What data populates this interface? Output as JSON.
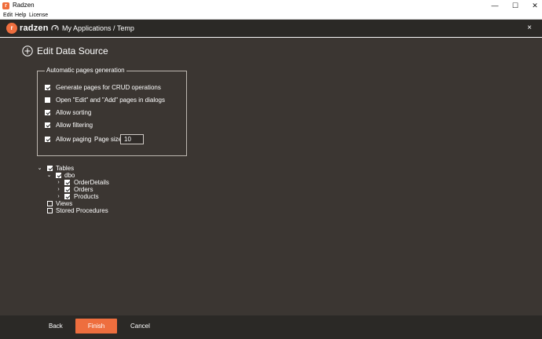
{
  "window": {
    "title": "Radzen",
    "logo_letter": "r",
    "minimize_glyph": "—",
    "maximize_glyph": "☐",
    "close_glyph": "✕"
  },
  "menu": {
    "items": [
      "Edit",
      "Help",
      "License"
    ]
  },
  "header": {
    "brand": "radzen",
    "brand_icon_letter": "r",
    "breadcrumb": "My Applications / Temp",
    "breadcrumb_icon": "gauge-icon",
    "close_glyph": "×"
  },
  "page": {
    "title": "Edit Data Source",
    "title_icon": "add-circle-icon"
  },
  "generation": {
    "legend": "Automatic pages generation",
    "options": [
      {
        "label": "Generate pages for CRUD operations",
        "checked": true
      },
      {
        "label": "Open \"Edit\" and \"Add\" pages in dialogs",
        "checked": false
      },
      {
        "label": "Allow sorting",
        "checked": true
      },
      {
        "label": "Allow filtering",
        "checked": true
      },
      {
        "label": "Allow paging",
        "checked": true
      }
    ],
    "page_size_label": "Page size",
    "page_size_value": "10"
  },
  "tree": {
    "tables": {
      "label": "Tables",
      "checked": true,
      "expanded": true
    },
    "dbo": {
      "label": "dbo",
      "checked": true,
      "expanded": true
    },
    "items": [
      {
        "label": "OrderDetails",
        "checked": true
      },
      {
        "label": "Orders",
        "checked": true
      },
      {
        "label": "Products",
        "checked": true
      }
    ],
    "views": {
      "label": "Views",
      "checked": false
    },
    "stored_procedures": {
      "label": "Stored Procedures",
      "checked": false
    },
    "expanded_glyph": "⌄",
    "collapsed_glyph": "›"
  },
  "footer": {
    "back_label": "Back",
    "finish_label": "Finish",
    "cancel_label": "Cancel"
  },
  "colors": {
    "accent": "#ee6e3e",
    "header_bg": "#2b2926",
    "main_bg": "#3b3632"
  }
}
